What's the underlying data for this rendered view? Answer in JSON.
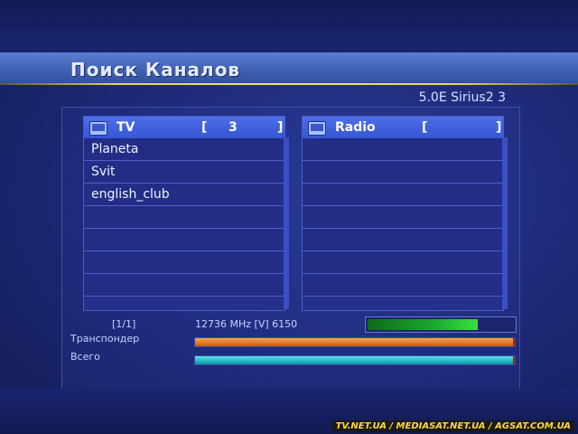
{
  "header": {
    "title": "Поиск Каналов",
    "satellite": "5.0E Sirius2 3"
  },
  "tv_panel": {
    "label": "TV",
    "open_bracket": "[",
    "count": "3",
    "close_bracket": "]",
    "channels": [
      "Planeta",
      "Svit",
      "english_club",
      "",
      "",
      "",
      "",
      ""
    ]
  },
  "radio_panel": {
    "label": "Radio",
    "open_bracket": "[",
    "count": "",
    "close_bracket": "]",
    "channels": [
      "",
      "",
      "",
      "",
      "",
      "",
      "",
      ""
    ]
  },
  "status": {
    "page": "[1/1]",
    "frequency": "12736 MHz [V] 6150",
    "signal_level": 0.75,
    "transponder_label": "Транспондер",
    "transponder_progress": 1.0,
    "total_label": "Всего",
    "total_progress": 1.0
  },
  "watermark": "TV.NET.UA / MEDIASAT.NET.UA / AGSAT.COM.UA",
  "colors": {
    "accent": "#3657d3",
    "signal": "#1aa830",
    "transponder_bar": "#e07820",
    "total_bar": "#20b8c4",
    "gold_line": "#e8d060"
  }
}
